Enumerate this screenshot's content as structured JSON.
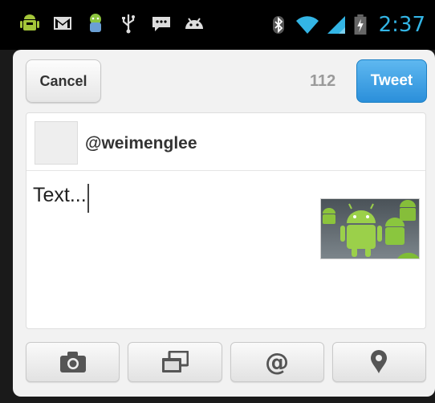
{
  "statusbar": {
    "time": "2:37",
    "left_icons": [
      "android-debug-icon",
      "gmail-icon",
      "android-robot-icon",
      "usb-icon",
      "chat-icon",
      "android-head-icon"
    ],
    "right_icons": [
      "bluetooth-icon",
      "wifi-icon",
      "signal-icon",
      "battery-charging-icon"
    ],
    "clock_color": "#33b5e5"
  },
  "dialog": {
    "cancel_label": "Cancel",
    "char_count": "112",
    "tweet_label": "Tweet",
    "accent": "#2b8fda"
  },
  "compose": {
    "handle": "@weimenglee",
    "text": "Text..."
  },
  "toolbar": {
    "buttons": [
      {
        "icon": "camera-icon"
      },
      {
        "icon": "gallery-icon"
      },
      {
        "icon": "mention-icon",
        "glyph": "@"
      },
      {
        "icon": "location-pin-icon"
      }
    ]
  }
}
